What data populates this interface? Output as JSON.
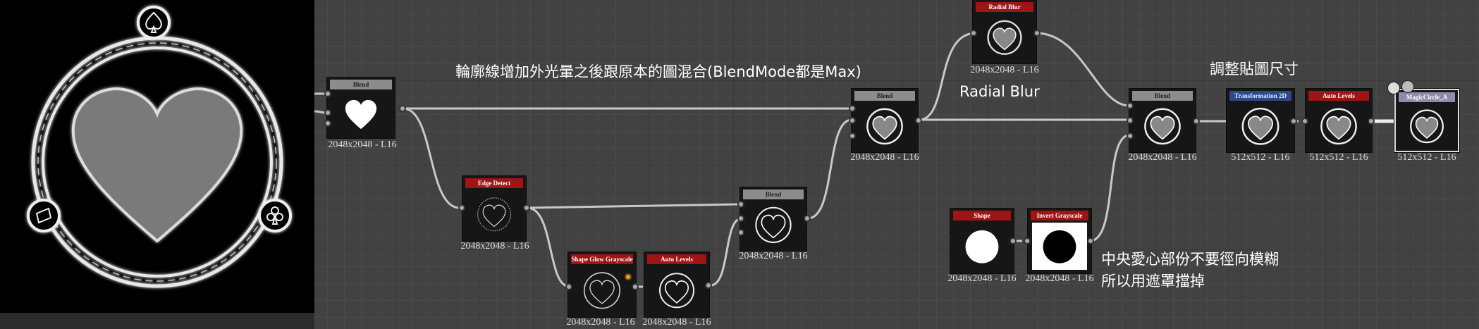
{
  "preview": {
    "description_icons": [
      "spade-icon",
      "diamond-icon",
      "club-icon",
      "heart-icon"
    ]
  },
  "notes": {
    "top": "輪廓線增加外光暈之後跟原本的圖混合(BlendMode都是Max)",
    "radial": "Radial Blur",
    "resize": "調整貼圖尺寸",
    "mask_line1": "中央愛心部份不要徑向模糊",
    "mask_line2": "所以用遮罩擋掉"
  },
  "nodes": {
    "blend1": {
      "title": "Blend",
      "res": "2048x2048 - L16"
    },
    "edge": {
      "title": "Edge Detect",
      "res": "2048x2048 - L16"
    },
    "glow": {
      "title": "Shape Glow Grayscale",
      "res": "2048x2048 - L16"
    },
    "levels1": {
      "title": "Auto Levels",
      "res": "2048x2048 - L16"
    },
    "blend2": {
      "title": "Blend",
      "res": "2048x2048 - L16"
    },
    "blend3": {
      "title": "Blend",
      "res": "2048x2048 - L16"
    },
    "radial": {
      "title": "Radial Blur",
      "res": "2048x2048 - L16"
    },
    "shape": {
      "title": "Shape",
      "res": "2048x2048 - L16"
    },
    "invert": {
      "title": "Invert Grayscale",
      "res": "2048x2048 - L16"
    },
    "blend4": {
      "title": "Blend",
      "res": "2048x2048 - L16"
    },
    "transform": {
      "title": "Transformation 2D",
      "res": "512x512 - L16"
    },
    "levels2": {
      "title": "Auto Levels",
      "res": "512x512 - L16"
    },
    "output": {
      "title": "MagicCircle_A",
      "res": "512x512 - L16"
    }
  },
  "colors": {
    "header_gray": "#8c8c8c",
    "header_red": "#a01414",
    "header_blue": "#2e4a86",
    "wire": "#c8c8c8",
    "graph_bg": "#424242"
  }
}
